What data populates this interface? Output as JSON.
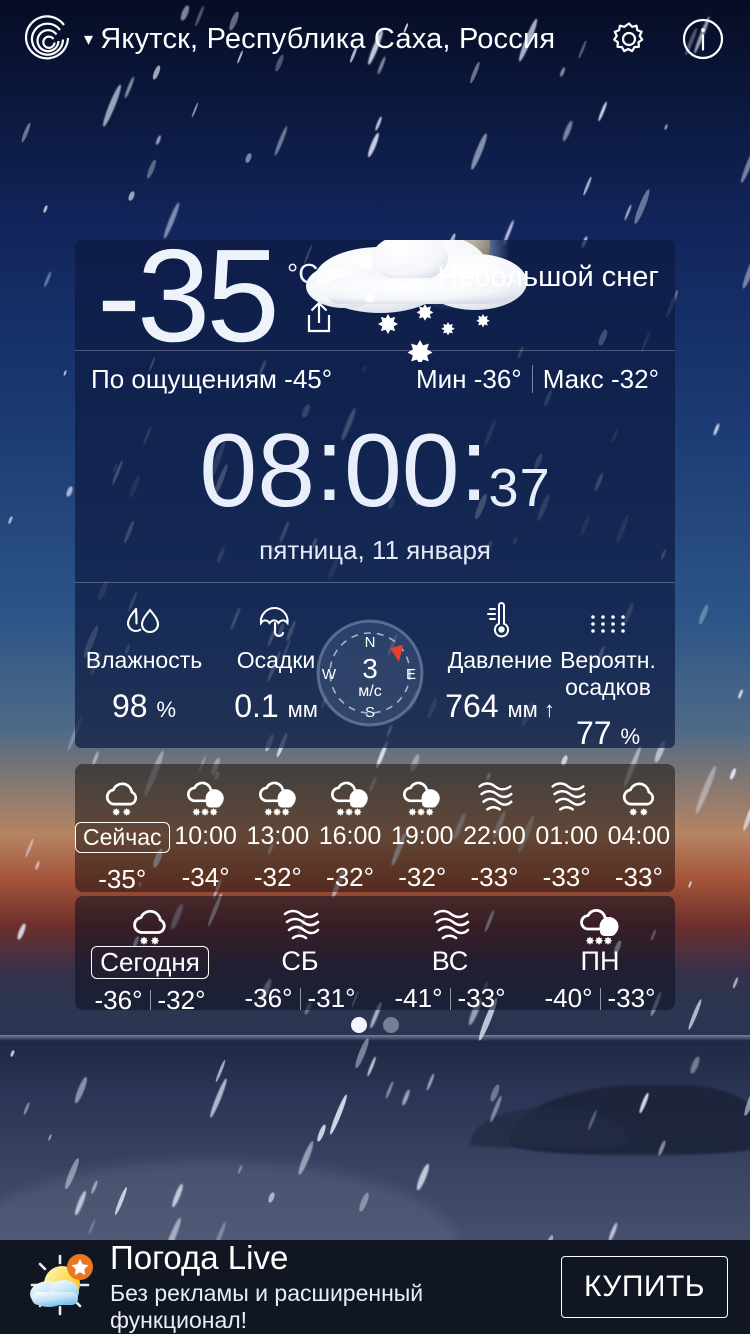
{
  "header": {
    "logo_icon": "radar-spiral-icon",
    "caret": "▾",
    "location": "Якутск, Республика Саха, Россия",
    "settings_icon": "gear-icon",
    "info_icon": "info-icon"
  },
  "current": {
    "temperature": "-35",
    "unit": "°C",
    "share_icon": "share-icon",
    "condition": "Небольшой снег",
    "weather_icon": "moon-cloud-snow-icon",
    "feels_like_label": "По ощущениям",
    "feels_like_value": "-45°",
    "min_label": "Мин",
    "min_value": "-36°",
    "max_label": "Макс",
    "max_value": "-32°"
  },
  "clock": {
    "hours": "08",
    "minutes": "00",
    "seconds": "37",
    "separator": ":",
    "date": "пятница, 11 января"
  },
  "metrics": [
    {
      "icon": "humidity-droplets-icon",
      "label": "Влажность",
      "value": "98",
      "unit": "%"
    },
    {
      "icon": "umbrella-icon",
      "label": "Осадки",
      "value": "0.1",
      "unit": "мм"
    },
    {
      "icon": "barometer-icon",
      "label": "Давление",
      "value": "764",
      "unit": "мм ↑"
    },
    {
      "icon": "rain-dots-icon",
      "label": "Вероятн. осадков",
      "value": "77",
      "unit": "%"
    }
  ],
  "wind": {
    "icon": "compass-icon",
    "speed": "3",
    "unit": "м/с",
    "north": "N",
    "east": "E",
    "south": "S",
    "west": "W",
    "direction_marker_color": "#e8402a"
  },
  "hourly": [
    {
      "icon": "cloud-snow-icon",
      "time": "Сейчас",
      "is_now": true,
      "temp": "-35°"
    },
    {
      "icon": "cloud-sun-snow-icon",
      "time": "10:00",
      "is_now": false,
      "temp": "-34°"
    },
    {
      "icon": "cloud-sun-snow-icon",
      "time": "13:00",
      "is_now": false,
      "temp": "-32°"
    },
    {
      "icon": "cloud-sun-snow-icon",
      "time": "16:00",
      "is_now": false,
      "temp": "-32°"
    },
    {
      "icon": "cloud-sun-snow-icon",
      "time": "19:00",
      "is_now": false,
      "temp": "-32°"
    },
    {
      "icon": "mist-icon",
      "time": "22:00",
      "is_now": false,
      "temp": "-33°"
    },
    {
      "icon": "mist-icon",
      "time": "01:00",
      "is_now": false,
      "temp": "-33°"
    },
    {
      "icon": "cloud-snow-icon",
      "time": "04:00",
      "is_now": false,
      "temp": "-33°"
    }
  ],
  "daily": [
    {
      "icon": "cloud-snow-icon",
      "name": "Сегодня",
      "is_today": true,
      "low": "-36°",
      "high": "-32°"
    },
    {
      "icon": "mist-icon",
      "name": "СБ",
      "is_today": false,
      "low": "-36°",
      "high": "-31°"
    },
    {
      "icon": "mist-icon",
      "name": "ВС",
      "is_today": false,
      "low": "-41°",
      "high": "-33°"
    },
    {
      "icon": "cloud-sun-snow-icon",
      "name": "ПН",
      "is_today": false,
      "low": "-40°",
      "high": "-33°"
    }
  ],
  "pager": {
    "total": 2,
    "active": 0
  },
  "ad": {
    "icon": "sun-cloud-star-icon",
    "title": "Погода Live",
    "subtitle": "Без рекламы и расширенный функционал!",
    "button": "КУПИТЬ"
  },
  "colors": {
    "accent_red": "#e8402a",
    "panel_bg": "#0d1940",
    "ad_bg": "#111722",
    "text": "#ffffff"
  }
}
